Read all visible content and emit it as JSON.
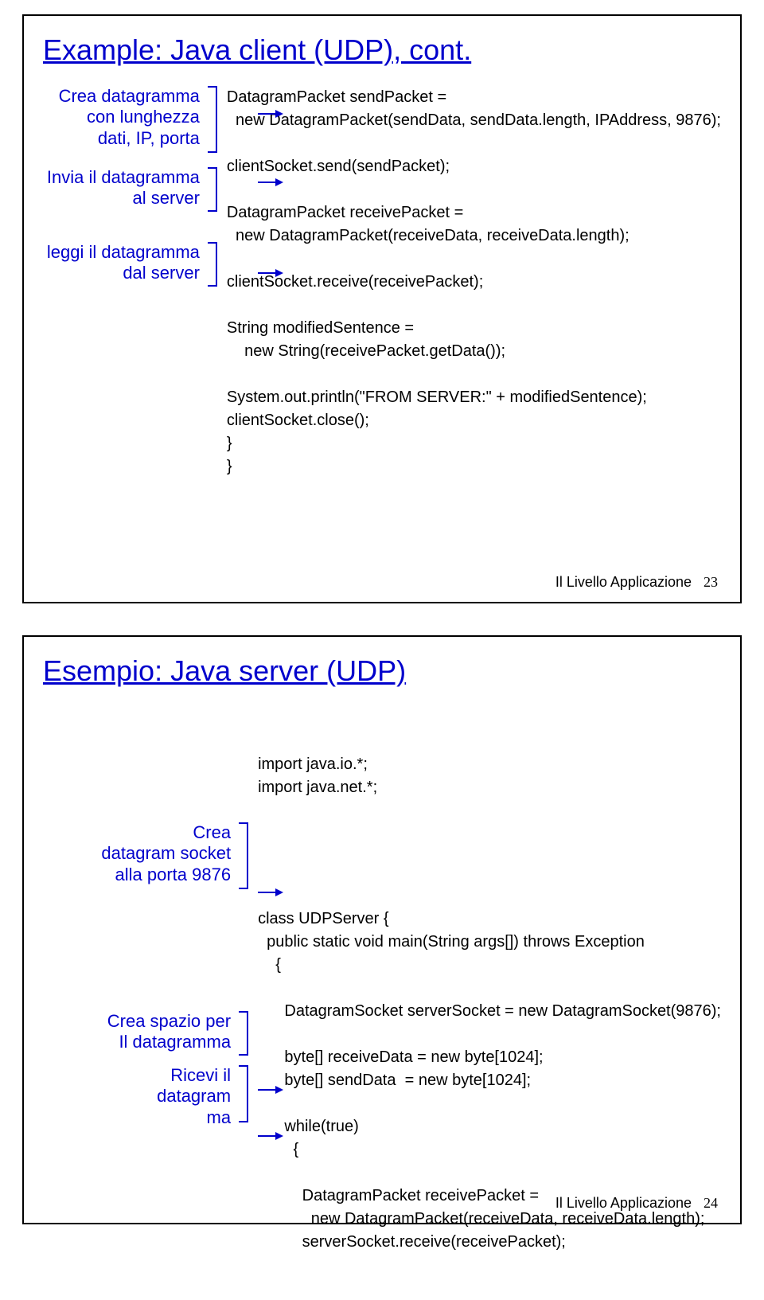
{
  "slide1": {
    "title": "Example: Java client (UDP), cont.",
    "annot1": "Crea datagramma\ncon lunghezza\ndati, IP, porta",
    "annot2": "Invia il datagramma\nal server",
    "annot3": "leggi il datagramma\ndal server",
    "code": "DatagramPacket sendPacket =\n  new DatagramPacket(sendData, sendData.length, IPAddress, 9876);\n\nclientSocket.send(sendPacket);\n\nDatagramPacket receivePacket =\n  new DatagramPacket(receiveData, receiveData.length);\n\nclientSocket.receive(receivePacket);\n\nString modifiedSentence =\n    new String(receivePacket.getData());\n\nSystem.out.println(\"FROM SERVER:\" + modifiedSentence);\nclientSocket.close();\n}\n}",
    "footer_label": "Il Livello Applicazione",
    "footer_num": "23"
  },
  "slide2": {
    "title": "Esempio: Java server (UDP)",
    "annot1": "Crea\ndatagram socket\nalla porta 9876",
    "annot2": "Crea spazio per\nIl datagramma",
    "annot3": "Ricevi il\ndatagram\nma",
    "code_top": "import java.io.*;\nimport java.net.*;",
    "code_mid": "class UDPServer {\n  public static void main(String args[]) throws Exception\n    {\n\n      DatagramSocket serverSocket = new DatagramSocket(9876);\n\n      byte[] receiveData = new byte[1024];\n      byte[] sendData  = new byte[1024];\n\n      while(true)\n        {\n\n          DatagramPacket receivePacket =\n            new DatagramPacket(receiveData, receiveData.length);\n          serverSocket.receive(receivePacket);",
    "footer_label": "Il Livello Applicazione",
    "footer_num": "24"
  }
}
